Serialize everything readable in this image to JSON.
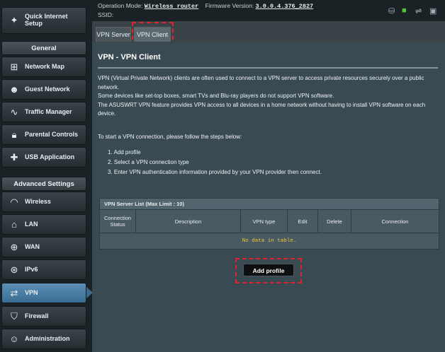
{
  "topbar": {
    "op_mode_label": "Operation Mode:",
    "op_mode_value": "Wireless router",
    "firmware_label": "Firmware Version:",
    "firmware_value": "3.0.0.4.376_2827",
    "ssid_label": "SSID:",
    "icons": [
      "usb-icon",
      "network-status-icon",
      "usb-plug-icon",
      "external-device-icon"
    ]
  },
  "sidebar": {
    "quick_setup": "Quick Internet Setup",
    "general_header": "General",
    "general_items": [
      "Network Map",
      "Guest Network",
      "Traffic Manager",
      "Parental Controls",
      "USB Application"
    ],
    "advanced_header": "Advanced Settings",
    "advanced_items": [
      "Wireless",
      "LAN",
      "WAN",
      "IPv6",
      "VPN",
      "Firewall",
      "Administration"
    ],
    "active_item": "VPN"
  },
  "tabs": [
    {
      "label": "VPN Server",
      "active": false
    },
    {
      "label": "VPN Client",
      "active": true
    }
  ],
  "content": {
    "title": "VPN - VPN Client",
    "paragraph_1": "VPN (Virtual Private Network) clients are often used to connect to a VPN server to access private resources securely over a public network.",
    "paragraph_2": "Some devices like set-top boxes, smart TVs and Blu-ray players do not support VPN software.",
    "paragraph_3": "The ASUSWRT VPN feature provides VPN access to all devices in a home network without having to install VPN software on each device.",
    "steps_intro": "To start a VPN connection, please follow the steps below:",
    "steps": [
      "1.  Add profile",
      "2.  Select a VPN connection type",
      "3.  Enter VPN authentication information provided by your VPN provider then connect."
    ]
  },
  "table": {
    "caption": "VPN Server List (Max Limit : 10)",
    "headers": [
      "Connection Status",
      "Description",
      "VPN type",
      "Edit",
      "Delete",
      "Connection"
    ],
    "empty_message": "No data in table."
  },
  "add_button": "Add profile",
  "highlight_color": "#e4202a"
}
